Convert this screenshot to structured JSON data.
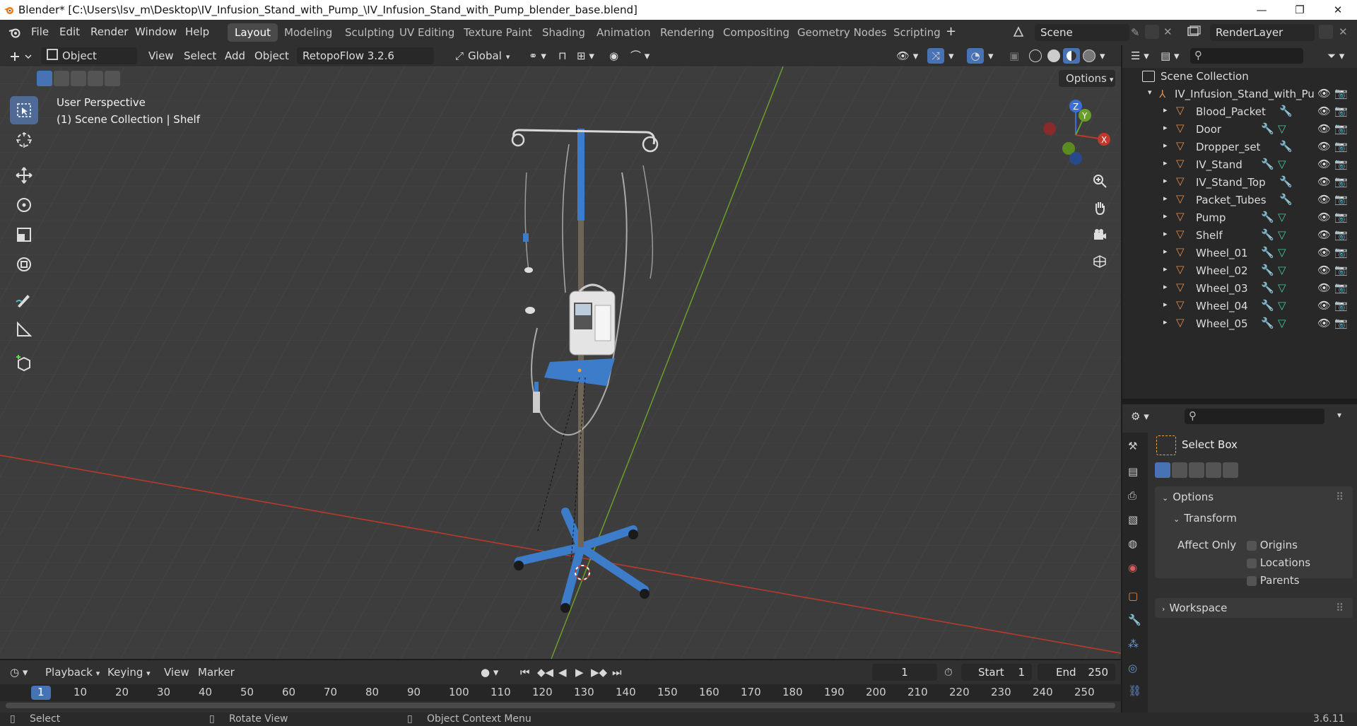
{
  "window": {
    "title": "Blender* [C:\\Users\\lsv_m\\Desktop\\IV_Infusion_Stand_with_Pump_\\IV_Infusion_Stand_with_Pump_blender_base.blend]",
    "min": "—",
    "max": "❐",
    "close": "✕"
  },
  "menu": [
    "File",
    "Edit",
    "Render",
    "Window",
    "Help"
  ],
  "workspaces": [
    {
      "label": "Layout",
      "active": true
    },
    {
      "label": "Modeling"
    },
    {
      "label": "Sculpting"
    },
    {
      "label": "UV Editing"
    },
    {
      "label": "Texture Paint"
    },
    {
      "label": "Shading"
    },
    {
      "label": "Animation"
    },
    {
      "label": "Rendering"
    },
    {
      "label": "Compositing"
    },
    {
      "label": "Geometry Nodes"
    },
    {
      "label": "Scripting"
    }
  ],
  "add_workspace": "+",
  "scene": {
    "label": "Scene"
  },
  "renderlayer": {
    "label": "RenderLayer"
  },
  "viewport_header": {
    "mode": "Object Mode",
    "view": "View",
    "select": "Select",
    "add": "Add",
    "object": "Object",
    "addon": "RetopoFlow 3.2.6 (github)",
    "orientation": "Global",
    "options": "Options"
  },
  "viewport": {
    "perspective": "User Perspective",
    "collection": "(1) Scene Collection | Shelf"
  },
  "gizmo": {
    "z": "Z",
    "y": "Y",
    "x": "X"
  },
  "outliner": {
    "root": "Scene Collection",
    "collection": "IV_Infusion_Stand_with_Pu",
    "objects": [
      {
        "name": "Blood_Packet",
        "mesh": false
      },
      {
        "name": "Door",
        "mesh": true
      },
      {
        "name": "Dropper_set",
        "mesh": false
      },
      {
        "name": "IV_Stand",
        "mesh": true
      },
      {
        "name": "IV_Stand_Top",
        "mesh": false
      },
      {
        "name": "Packet_Tubes",
        "mesh": false
      },
      {
        "name": "Pump",
        "mesh": true
      },
      {
        "name": "Shelf",
        "mesh": true
      },
      {
        "name": "Wheel_01",
        "mesh": true
      },
      {
        "name": "Wheel_02",
        "mesh": true
      },
      {
        "name": "Wheel_03",
        "mesh": true
      },
      {
        "name": "Wheel_04",
        "mesh": true
      },
      {
        "name": "Wheel_05",
        "mesh": true
      }
    ]
  },
  "properties": {
    "tool": "Select Box",
    "options": "Options",
    "transform": "Transform",
    "affect_only": "Affect Only",
    "origins": "Origins",
    "locations": "Locations",
    "parents": "Parents",
    "workspace": "Workspace"
  },
  "timeline": {
    "playback": "Playback",
    "keying": "Keying",
    "view": "View",
    "marker": "Marker",
    "current_frame": "1",
    "start_label": "Start",
    "start": "1",
    "end_label": "End",
    "end": "250",
    "ruler": [
      "1",
      "10",
      "20",
      "30",
      "40",
      "50",
      "60",
      "70",
      "80",
      "90",
      "100",
      "110",
      "120",
      "130",
      "140",
      "150",
      "160",
      "170",
      "180",
      "190",
      "200",
      "210",
      "220",
      "230",
      "240",
      "250"
    ]
  },
  "status": {
    "select": "Select",
    "rotate": "Rotate View",
    "context": "Object Context Menu",
    "version": "3.6.11"
  },
  "colors": {
    "accent": "#4772b3",
    "x_axis": "#c0392b",
    "y_axis": "#6a9e2a",
    "object_icon": "#e08b4a",
    "mesh_icon": "#46c89a",
    "modifier_icon": "#6b95e8"
  }
}
